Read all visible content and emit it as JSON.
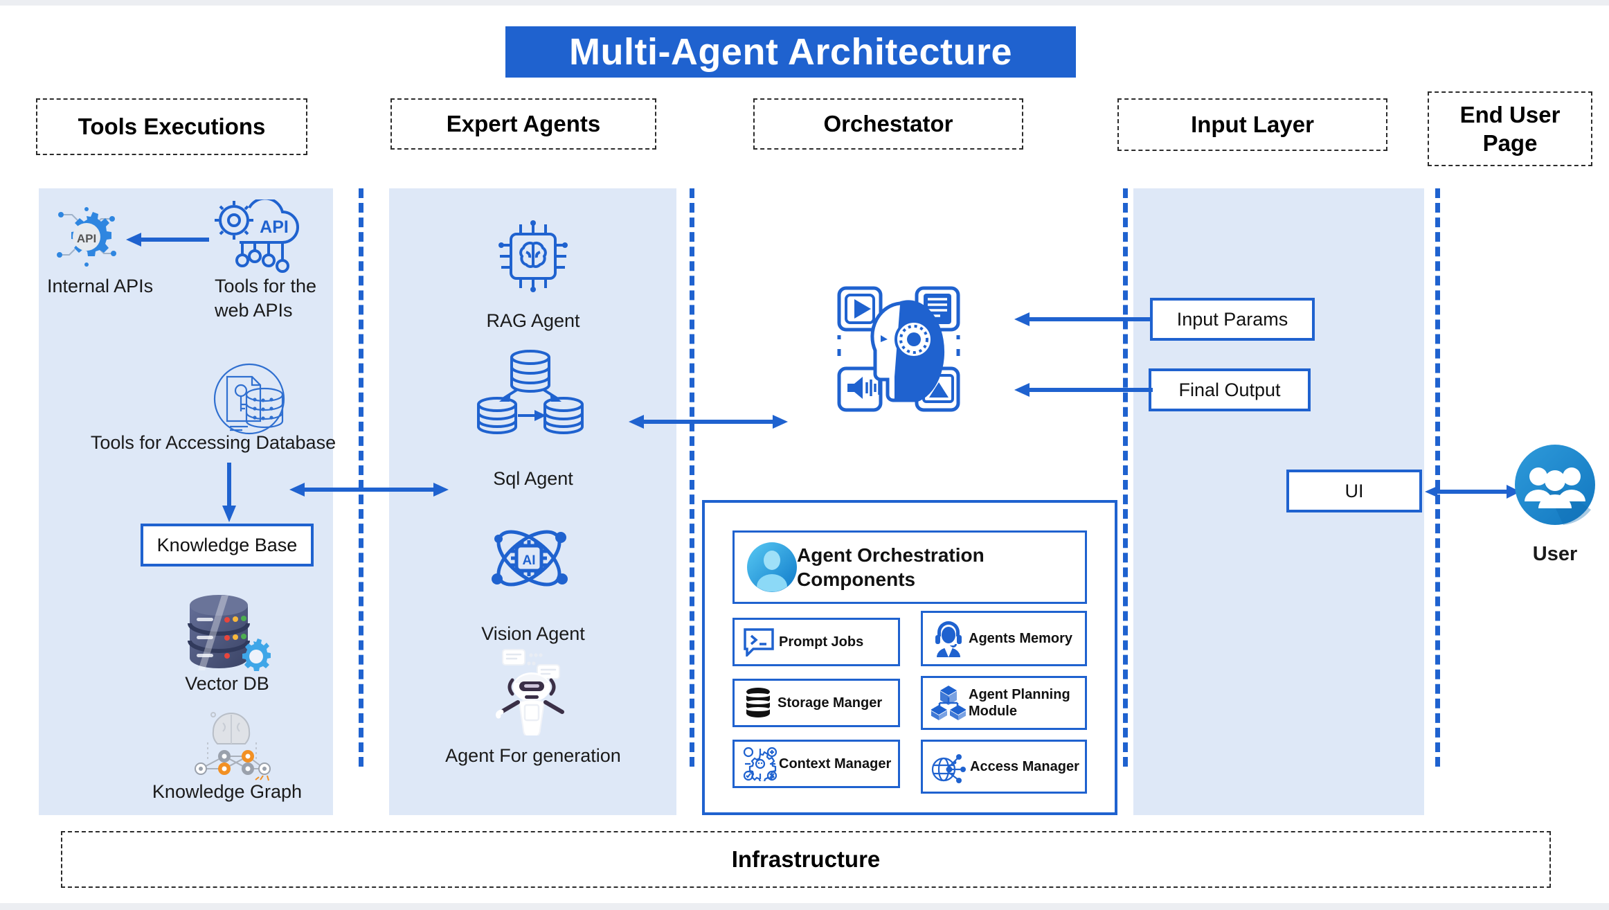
{
  "title": "Multi-Agent Architecture",
  "headers": [
    {
      "label": "Tools Executions"
    },
    {
      "label": "Expert Agents"
    },
    {
      "label": "Orchestator"
    },
    {
      "label": "Input Layer"
    },
    {
      "label": "End User Page"
    }
  ],
  "tools_execution": {
    "internal_apis_label": "Internal APIs",
    "web_apis_label": "Tools for the web APIs",
    "db_tools_label": "Tools for Accessing Database",
    "knowledge_base_label": "Knowledge Base",
    "vector_db_label": "Vector DB",
    "knowledge_graph_label": "Knowledge Graph"
  },
  "expert_agents": {
    "rag_label": "RAG Agent",
    "sql_label": "Sql Agent",
    "vision_label": "Vision Agent",
    "generation_label": "Agent For generation"
  },
  "orchestrator": {
    "panel_title": "Agent Orchestration Components",
    "components": [
      {
        "label": "Prompt Jobs",
        "icon": "terminal-prompt-icon"
      },
      {
        "label": "Agents Memory",
        "icon": "headset-agent-icon"
      },
      {
        "label": "Storage Manger",
        "icon": "database-stack-icon"
      },
      {
        "label": "Agent Planning Module",
        "icon": "cube-network-icon"
      },
      {
        "label": "Context Manager",
        "icon": "gear-context-icon"
      },
      {
        "label": "Access Manager",
        "icon": "globe-network-icon"
      }
    ]
  },
  "input_layer": {
    "input_params_label": "Input Params",
    "final_output_label": "Final Output",
    "ui_label": "UI"
  },
  "end_user": {
    "user_label": "User"
  },
  "infrastructure": {
    "label": "Infrastructure"
  },
  "colors": {
    "accent_blue": "#1f62cf",
    "band_blue": "#dee8f7",
    "title_bg": "#1f62cf",
    "text_dark": "#111111"
  }
}
